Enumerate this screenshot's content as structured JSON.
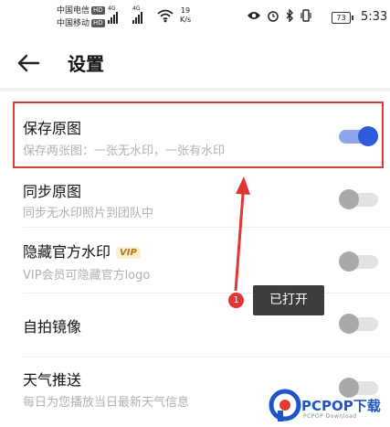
{
  "status_bar": {
    "carrier1": "中国电信",
    "carrier2": "中国移动",
    "hd": "HD",
    "net1": "4G",
    "net2": "4G",
    "speed_value": "19",
    "speed_unit": "K/s",
    "battery": "73",
    "time": "5:33"
  },
  "header": {
    "title": "设置"
  },
  "settings": [
    {
      "name": "保存原图",
      "desc": "保存两张图：一张无水印，一张有水印",
      "enabled": true
    },
    {
      "name": "同步原图",
      "desc": "同步无水印照片到团队中",
      "enabled": false
    },
    {
      "name": "隐藏官方水印",
      "badge": "VIP",
      "desc": "VIP会员可隐藏官方logo",
      "enabled": false
    },
    {
      "name": "自拍镜像",
      "desc": "",
      "enabled": false
    },
    {
      "name": "天气推送",
      "desc": "每日为您播放当日最新天气信息",
      "enabled": false
    }
  ],
  "annotation": {
    "number": "1",
    "text": "已打开"
  },
  "watermark": {
    "brand": "PCPOP下载",
    "sub": "PCPOP Download"
  },
  "colors": {
    "accent": "#2e5bdc",
    "highlight": "#e03a3a",
    "arrow": "#e23535"
  }
}
